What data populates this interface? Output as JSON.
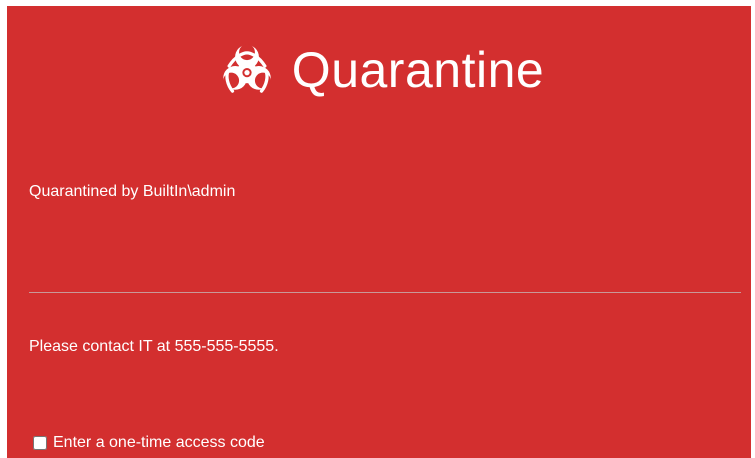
{
  "app": {
    "title": "Quarantine",
    "logo_icon": "biohazard-icon",
    "background_color": "#d32f2f"
  },
  "details": {
    "quarantined_by": "Quarantined by BuiltIn\\admin",
    "contact_message": "Please contact IT at 555-555-5555."
  },
  "access": {
    "checkbox_label": "Enter a one-time access code",
    "checked": false
  }
}
